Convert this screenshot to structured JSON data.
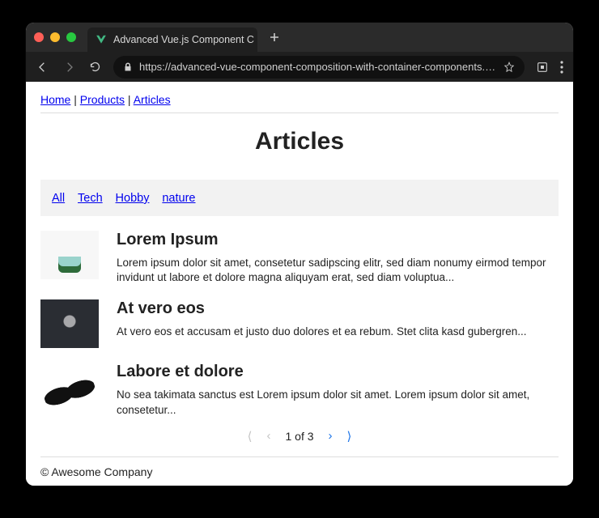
{
  "browser": {
    "tab_title": "Advanced Vue.js Component C",
    "url_display": "https://advanced-vue-component-composition-with-container-components.netlify.com/articl…"
  },
  "breadcrumb": {
    "items": [
      "Home",
      "Products",
      "Articles"
    ]
  },
  "page_title": "Articles",
  "filters": [
    "All",
    "Tech",
    "Hobby",
    "nature"
  ],
  "articles": [
    {
      "title": "Lorem Ipsum",
      "excerpt": "Lorem ipsum dolor sit amet, consetetur sadipscing elitr, sed diam nonumy eirmod tempor invidunt ut labore et dolore magna aliquyam erat, sed diam voluptua...",
      "thumb_kind": "plant"
    },
    {
      "title": "At vero eos",
      "excerpt": "At vero eos et accusam et justo duo dolores et ea rebum. Stet clita kasd gubergren...",
      "thumb_kind": "dark"
    },
    {
      "title": "Labore et dolore",
      "excerpt": "No sea takimata sanctus est Lorem ipsum dolor sit amet. Lorem ipsum dolor sit amet, consetetur...",
      "thumb_kind": "glasses"
    }
  ],
  "pagination": {
    "label": "1 of 3",
    "first_disabled": true,
    "prev_disabled": true,
    "next_disabled": false,
    "last_disabled": false
  },
  "footer": "© Awesome Company"
}
